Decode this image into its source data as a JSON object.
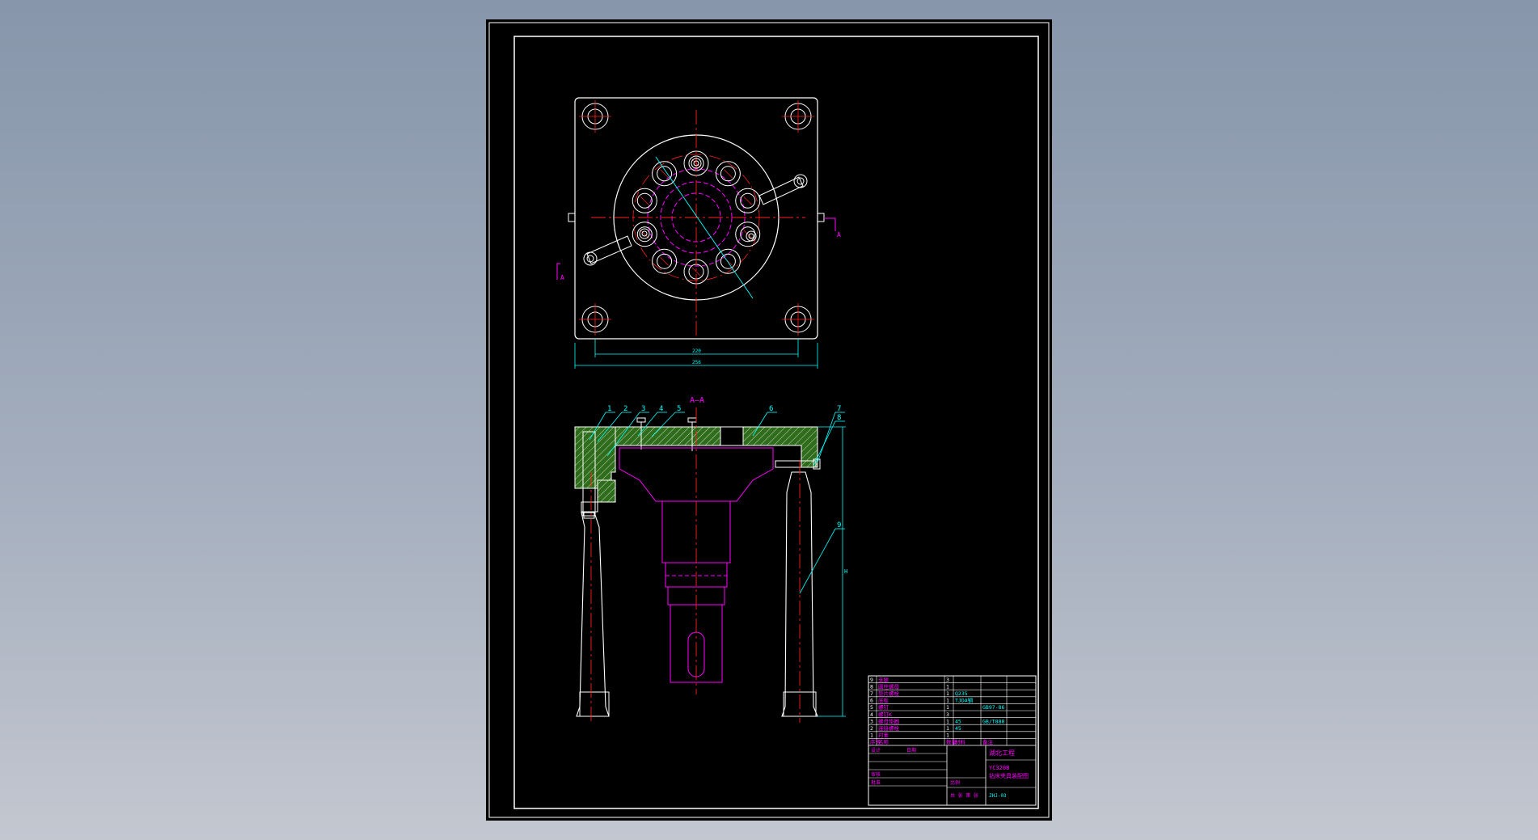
{
  "drawing": {
    "section_label": "A–A",
    "cut_label": "A",
    "leader_labels": [
      "1",
      "2",
      "3",
      "4",
      "5",
      "6",
      "7",
      "8",
      "9"
    ],
    "plan_dims": {
      "inner": "220",
      "outer": "256"
    },
    "height_dim": "H",
    "small_note": "M"
  },
  "title_block": {
    "bom_rows": [
      {
        "no": "9",
        "name": "支腿",
        "qty": "3",
        "material": "",
        "standard": ""
      },
      {
        "no": "8",
        "name": "圆柱螺母",
        "qty": "1",
        "material": "",
        "standard": ""
      },
      {
        "no": "7",
        "name": "垫片螺栓",
        "qty": "1",
        "material": "Q235",
        "standard": ""
      },
      {
        "no": "6",
        "name": "底板",
        "qty": "1",
        "material": "TJDA钢",
        "standard": ""
      },
      {
        "no": "5",
        "name": "螺钉",
        "qty": "1",
        "material": "",
        "standard": "GB97-86"
      },
      {
        "no": "4",
        "name": "螺钉K",
        "qty": "3",
        "material": "",
        "standard": ""
      },
      {
        "no": "3",
        "name": "螺母垫圈",
        "qty": "1",
        "material": "45",
        "standard": "GB/T888"
      },
      {
        "no": "2",
        "name": "连接螺栓",
        "qty": "1",
        "material": "45",
        "standard": ""
      },
      {
        "no": "1",
        "name": "衬套",
        "qty": "1",
        "material": "",
        "standard": ""
      }
    ],
    "headers": [
      "序号",
      "名称",
      "数量",
      "材料",
      "备注"
    ],
    "school": "湖北工程",
    "drawing_title": [
      "YC320B",
      "钻床夹具装配图"
    ],
    "drawing_no": "ZHJ-03",
    "scale_label": "比例",
    "sheet_label": "共 张 第 张",
    "designer_label": "设计",
    "checker_label": "审核",
    "approver_label": "批准",
    "date_label": "日期"
  },
  "colors": {
    "background_top": "#8796ab",
    "sheet": "#000000",
    "outline": "#ffffff",
    "centerline": "#ff2020",
    "hidden": "#ff00ff",
    "dimension": "#00ffff",
    "hatch": "#3a7a20",
    "hatch_line": "#e0e0e0"
  }
}
